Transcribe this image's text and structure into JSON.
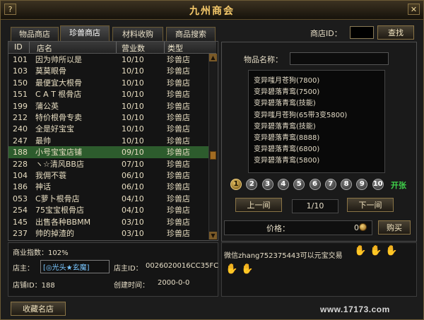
{
  "window": {
    "title": "九州商会",
    "help_icon": "?",
    "close_icon": "✕"
  },
  "tabs": [
    {
      "label": "物品商店",
      "active": false
    },
    {
      "label": "珍兽商店",
      "active": true
    },
    {
      "label": "材料收购",
      "active": false
    },
    {
      "label": "商品搜索",
      "active": false
    }
  ],
  "search": {
    "shop_id_label": "商店ID：",
    "shop_id_value": "",
    "search_button": "查找"
  },
  "shop_list": {
    "columns": [
      "ID",
      "店名",
      "营业数",
      "类型"
    ],
    "rows": [
      {
        "id": "101",
        "name": "因为帅所以是",
        "count": "10/10",
        "type": "珍兽店"
      },
      {
        "id": "103",
        "name": "莫莫眼骨",
        "count": "10/10",
        "type": "珍兽店"
      },
      {
        "id": "150",
        "name": "最便宜大根骨",
        "count": "10/10",
        "type": "珍兽店"
      },
      {
        "id": "151",
        "name": "C A T 根骨店",
        "count": "10/10",
        "type": "珍兽店"
      },
      {
        "id": "199",
        "name": "蒲公英",
        "count": "10/10",
        "type": "珍兽店"
      },
      {
        "id": "212",
        "name": "特价根骨专卖",
        "count": "10/10",
        "type": "珍兽店"
      },
      {
        "id": "240",
        "name": "全是好宝宝",
        "count": "10/10",
        "type": "珍兽店"
      },
      {
        "id": "247",
        "name": "最帅",
        "count": "10/10",
        "type": "珍兽店"
      },
      {
        "id": "188",
        "name": "小号宝宝店铺",
        "count": "09/10",
        "type": "珍兽店",
        "selected": true
      },
      {
        "id": "228",
        "name": "ヽ☆清风BB店",
        "count": "07/10",
        "type": "珍兽店"
      },
      {
        "id": "104",
        "name": "我佣不蓑",
        "count": "06/10",
        "type": "珍兽店"
      },
      {
        "id": "186",
        "name": "神话",
        "count": "06/10",
        "type": "珍兽店"
      },
      {
        "id": "053",
        "name": "C萝卜根骨店",
        "count": "04/10",
        "type": "珍兽店"
      },
      {
        "id": "254",
        "name": "75宝宝根骨店",
        "count": "04/10",
        "type": "珍兽店"
      },
      {
        "id": "145",
        "name": "出售各种BBMM",
        "count": "03/10",
        "type": "珍兽店"
      },
      {
        "id": "237",
        "name": "帅的掉渣的",
        "count": "03/10",
        "type": "珍兽店"
      }
    ]
  },
  "detail": {
    "item_name_label": "物品名称：",
    "item_name_value": "",
    "items": [
      "变异嗤月苍狗(7800)",
      "变异碧落青鸾(7500)",
      "变异碧落青鸾(技能)",
      "变异嗤月苍狗(65带3变5800)",
      "变异碧落青鸾(技能)",
      "变异碧落青鸾(8888)",
      "变异碧落青鸾(6800)",
      "变异碧落青鸾(5800)"
    ],
    "pages": [
      "1",
      "2",
      "3",
      "4",
      "5",
      "6",
      "7",
      "8",
      "9",
      "10"
    ],
    "current_page_index": 0,
    "open_label": "开张",
    "prev_button": "上一间",
    "next_button": "下一间",
    "page_indicator": "1/10",
    "price_label": "价格：",
    "price_value": "0",
    "buy_button": "购买"
  },
  "shop_info": {
    "business_index": "商业指数：102%",
    "owner_label": "店主：",
    "owner_value": "[◎光头★玄魔]",
    "owner_id_label": "店主ID：",
    "owner_id_value": "0026020016CC35FC",
    "shop_id_line": "店铺ID：188",
    "created_label": "创建时间：",
    "created_value": "2000-0-0",
    "favorite_button": "收藏名店"
  },
  "message": {
    "text": "微信zhang752375443可以元宝交易"
  },
  "watermark": "www.17173.com"
}
